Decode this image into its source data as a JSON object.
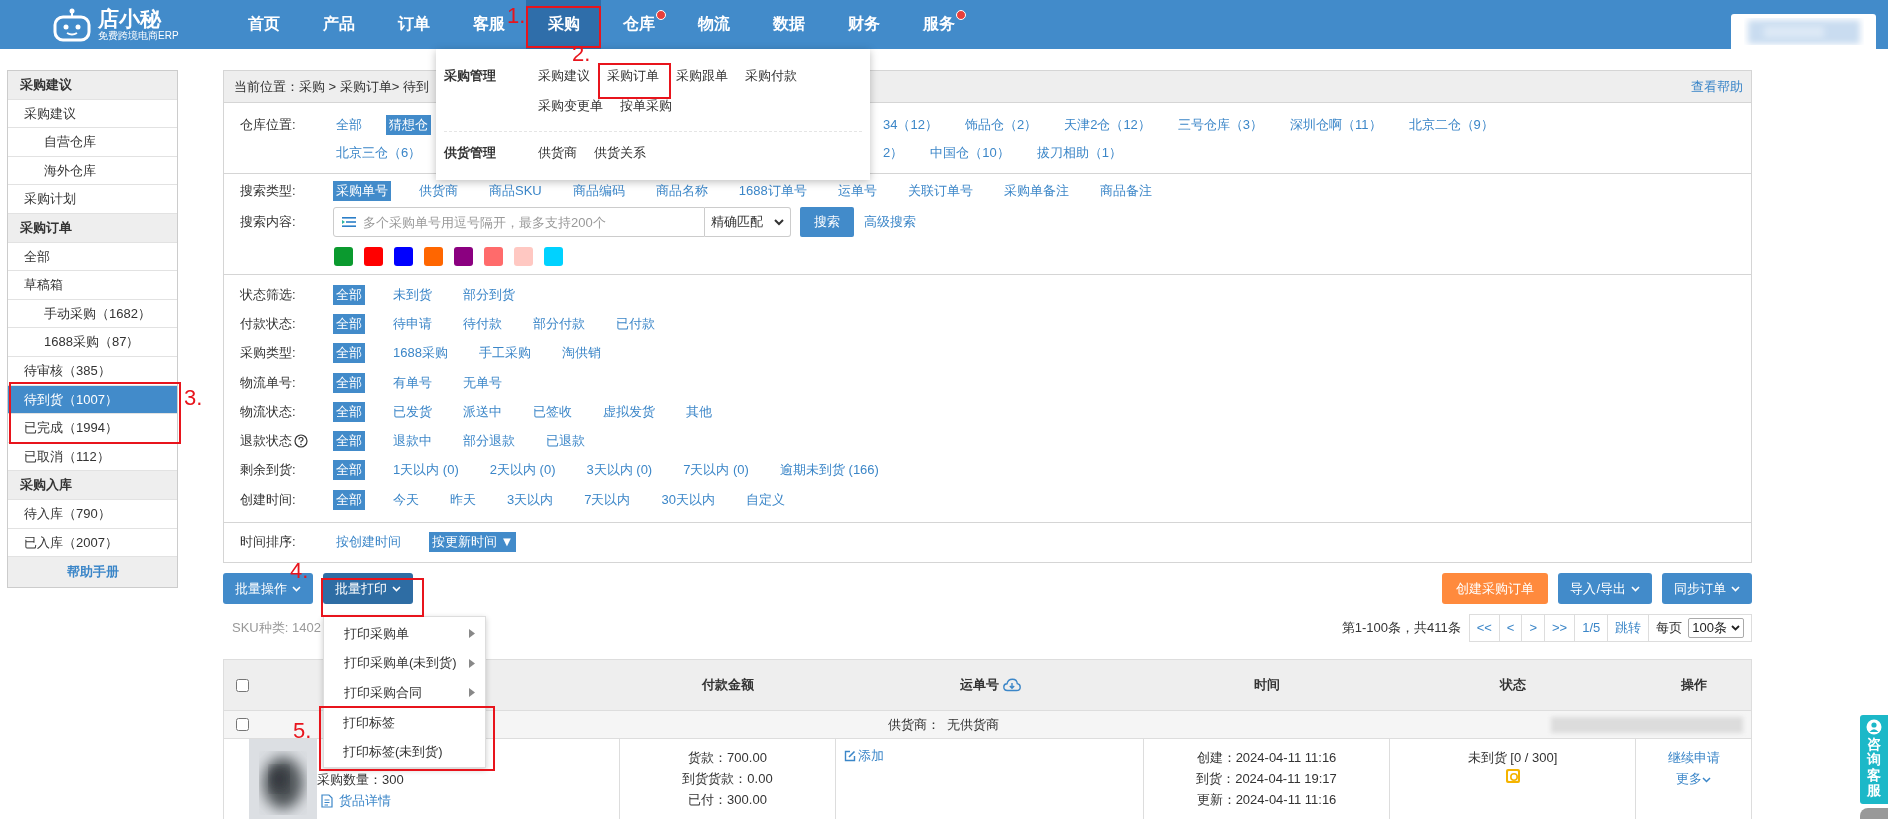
{
  "logo": {
    "name": "店小秘",
    "tagline": "免费跨境电商ERP"
  },
  "nav": [
    {
      "label": "首页",
      "selected": false,
      "badge": false
    },
    {
      "label": "产品",
      "selected": false,
      "badge": false
    },
    {
      "label": "订单",
      "selected": false,
      "badge": false
    },
    {
      "label": "客服",
      "selected": false,
      "badge": false
    },
    {
      "label": "采购",
      "selected": true,
      "badge": false
    },
    {
      "label": "仓库",
      "selected": false,
      "badge": true
    },
    {
      "label": "物流",
      "selected": false,
      "badge": false
    },
    {
      "label": "数据",
      "selected": false,
      "badge": false
    },
    {
      "label": "财务",
      "selected": false,
      "badge": false
    },
    {
      "label": "服务",
      "selected": false,
      "badge": true
    }
  ],
  "nav_menu": [
    {
      "title": "采购管理",
      "rows": [
        [
          "采购建议",
          "采购订单",
          "采购跟单",
          "采购付款"
        ],
        [
          "采购变更单",
          "按单采购"
        ]
      ]
    },
    {
      "title": "供货管理",
      "rows": [
        [
          "供货商",
          "供货关系"
        ]
      ]
    }
  ],
  "sidebar": {
    "sections": [
      {
        "title": "采购建议",
        "items": [
          {
            "label": "采购建议",
            "selected": false,
            "children": [
              {
                "label": "自营仓库",
                "selected": false
              },
              {
                "label": "海外仓库",
                "selected": false
              }
            ]
          },
          {
            "label": "采购计划",
            "selected": false
          }
        ]
      },
      {
        "title": "采购订单",
        "items": [
          {
            "label": "全部",
            "selected": false
          },
          {
            "label": "草稿箱",
            "selected": false,
            "children": [
              {
                "label": "手动采购（1682）",
                "selected": false
              },
              {
                "label": "1688采购（87）",
                "selected": false
              }
            ]
          },
          {
            "label": "待审核（385）",
            "selected": false
          },
          {
            "label": "待到货（1007）",
            "selected": true
          },
          {
            "label": "已完成（1994）",
            "selected": false
          },
          {
            "label": "已取消（112）",
            "selected": false
          }
        ]
      },
      {
        "title": "采购入库",
        "items": [
          {
            "label": "待入库（790）",
            "selected": false
          },
          {
            "label": "已入库（2007）",
            "selected": false
          }
        ]
      }
    ],
    "footer": "帮助手册"
  },
  "breadcrumb": "当前位置：采购 > 采购订单> 待到",
  "help_link": "查看帮助",
  "warehouse": {
    "label": "仓库位置:",
    "rows": [
      {
        "left": [
          {
            "label": "全部",
            "selected": false
          },
          {
            "label": "猜想仓",
            "selected": true
          }
        ],
        "right": [
          {
            "label": "34（12）",
            "selected": false
          },
          {
            "label": "饰品仓（2）",
            "selected": false
          },
          {
            "label": "天津2仓（12）",
            "selected": false
          },
          {
            "label": "三号仓库（3）",
            "selected": false
          },
          {
            "label": "深圳仓啊（11）",
            "selected": false
          },
          {
            "label": "北京二仓（9）",
            "selected": false
          }
        ]
      },
      {
        "left": [
          {
            "label": "北京三仓（6）",
            "selected": false
          }
        ],
        "right": [
          {
            "label": "2）",
            "selected": false
          },
          {
            "label": "中国仓（10）",
            "selected": false
          },
          {
            "label": "拔刀相助（1）",
            "selected": false
          }
        ]
      }
    ]
  },
  "search_type": {
    "label": "搜索类型:",
    "options": [
      {
        "label": "采购单号",
        "selected": true
      },
      {
        "label": "供货商",
        "selected": false
      },
      {
        "label": "商品SKU",
        "selected": false
      },
      {
        "label": "商品编码",
        "selected": false
      },
      {
        "label": "商品名称",
        "selected": false
      },
      {
        "label": "1688订单号",
        "selected": false
      },
      {
        "label": "运单号",
        "selected": false
      },
      {
        "label": "关联订单号",
        "selected": false
      },
      {
        "label": "采购单备注",
        "selected": false
      },
      {
        "label": "商品备注",
        "selected": false
      }
    ]
  },
  "search": {
    "label": "搜索内容:",
    "placeholder": "多个采购单号用逗号隔开，最多支持200个",
    "match": "精确匹配",
    "button": "搜索",
    "advanced": "高级搜索"
  },
  "color_tags": [
    {
      "color": "#0b9a2f"
    },
    {
      "color": "#ff0000"
    },
    {
      "color": "#0000ff"
    },
    {
      "color": "#ff6600"
    },
    {
      "color": "#8b0080"
    },
    {
      "color": "#ff6b6b"
    },
    {
      "color": "#ffc8c2"
    },
    {
      "color": "#00d2ff"
    }
  ],
  "filters": [
    {
      "label": "状态筛选:",
      "help": false,
      "options": [
        {
          "label": "全部",
          "selected": true
        },
        {
          "label": "未到货",
          "selected": false
        },
        {
          "label": "部分到货",
          "selected": false
        }
      ]
    },
    {
      "label": "付款状态:",
      "help": false,
      "options": [
        {
          "label": "全部",
          "selected": true
        },
        {
          "label": "待申请",
          "selected": false
        },
        {
          "label": "待付款",
          "selected": false
        },
        {
          "label": "部分付款",
          "selected": false
        },
        {
          "label": "已付款",
          "selected": false
        }
      ]
    },
    {
      "label": "采购类型:",
      "help": false,
      "options": [
        {
          "label": "全部",
          "selected": true
        },
        {
          "label": "1688采购",
          "selected": false
        },
        {
          "label": "手工采购",
          "selected": false
        },
        {
          "label": "淘供销",
          "selected": false
        }
      ]
    },
    {
      "label": "物流单号:",
      "help": false,
      "options": [
        {
          "label": "全部",
          "selected": true
        },
        {
          "label": "有单号",
          "selected": false
        },
        {
          "label": "无单号",
          "selected": false
        }
      ]
    },
    {
      "label": "物流状态:",
      "help": false,
      "options": [
        {
          "label": "全部",
          "selected": true
        },
        {
          "label": "已发货",
          "selected": false
        },
        {
          "label": "派送中",
          "selected": false
        },
        {
          "label": "已签收",
          "selected": false
        },
        {
          "label": "虚拟发货",
          "selected": false
        },
        {
          "label": "其他",
          "selected": false
        }
      ]
    },
    {
      "label": "退款状态",
      "help": true,
      "options": [
        {
          "label": "全部",
          "selected": true
        },
        {
          "label": "退款中",
          "selected": false
        },
        {
          "label": "部分退款",
          "selected": false
        },
        {
          "label": "已退款",
          "selected": false
        }
      ]
    },
    {
      "label": "剩余到货:",
      "help": false,
      "options": [
        {
          "label": "全部",
          "selected": true
        },
        {
          "label": "1天以内 (0)",
          "selected": false
        },
        {
          "label": "2天以内 (0)",
          "selected": false
        },
        {
          "label": "3天以内 (0)",
          "selected": false
        },
        {
          "label": "7天以内 (0)",
          "selected": false
        },
        {
          "label": "逾期未到货 (166)",
          "selected": false
        }
      ]
    },
    {
      "label": "创建时间:",
      "help": false,
      "options": [
        {
          "label": "全部",
          "selected": true
        },
        {
          "label": "今天",
          "selected": false
        },
        {
          "label": "昨天",
          "selected": false
        },
        {
          "label": "3天以内",
          "selected": false
        },
        {
          "label": "7天以内",
          "selected": false
        },
        {
          "label": "30天以内",
          "selected": false
        },
        {
          "label": "自定义",
          "selected": false
        }
      ]
    }
  ],
  "sort": {
    "label": "时间排序:",
    "options": [
      {
        "label": "按创建时间",
        "selected": false
      },
      {
        "label": "按更新时间 ▼",
        "selected": true
      }
    ]
  },
  "toolbar": {
    "left": [
      {
        "label": "批量操作",
        "open": false
      },
      {
        "label": "批量打印",
        "open": true
      }
    ],
    "right": [
      {
        "label": "创建采购订单",
        "kind": "primary"
      },
      {
        "label": "导入/导出",
        "kind": "dropdown"
      },
      {
        "label": "同步订单",
        "kind": "dropdown"
      }
    ]
  },
  "print_menu": [
    {
      "label": "打印采购单",
      "submenu": true
    },
    {
      "label": "打印采购单(未到货)",
      "submenu": true
    },
    {
      "label": "打印采购合同",
      "submenu": true
    },
    {
      "label": "打印标签",
      "submenu": false
    },
    {
      "label": "打印标签(未到货)",
      "submenu": false
    }
  ],
  "sku_count": "SKU种类: 1402",
  "pagination": {
    "summary": "第1-100条，共411条",
    "buttons": [
      "<<",
      "<",
      ">",
      ">>"
    ],
    "page": "1/5",
    "jump": "跳转",
    "per_page_label": "每页",
    "per_page": "100条"
  },
  "table": {
    "header_checked": false,
    "columns": [
      "付款金额",
      "运单号",
      "时间",
      "状态",
      "操作"
    ],
    "supplier_row": {
      "checked": false,
      "text": "供货商：  无供货商"
    },
    "rows": [
      {
        "quantity": "采购数量：300",
        "details": "货品详情",
        "payment": [
          "货款：700.00",
          "到货货款：0.00",
          "已付：300.00"
        ],
        "waybill": "添加",
        "times": [
          "创建：2024-04-11 11:16",
          "到货：2024-04-11 19:17",
          "更新：2024-04-11 11:16"
        ],
        "status": "未到货 [0 / 300]",
        "actions": [
          "继续申请",
          "更多"
        ]
      }
    ]
  },
  "support_tab": "咨询客服",
  "annotations": [
    {
      "label": "1."
    },
    {
      "label": "2."
    },
    {
      "label": "3."
    },
    {
      "label": "4."
    },
    {
      "label": "5."
    }
  ]
}
